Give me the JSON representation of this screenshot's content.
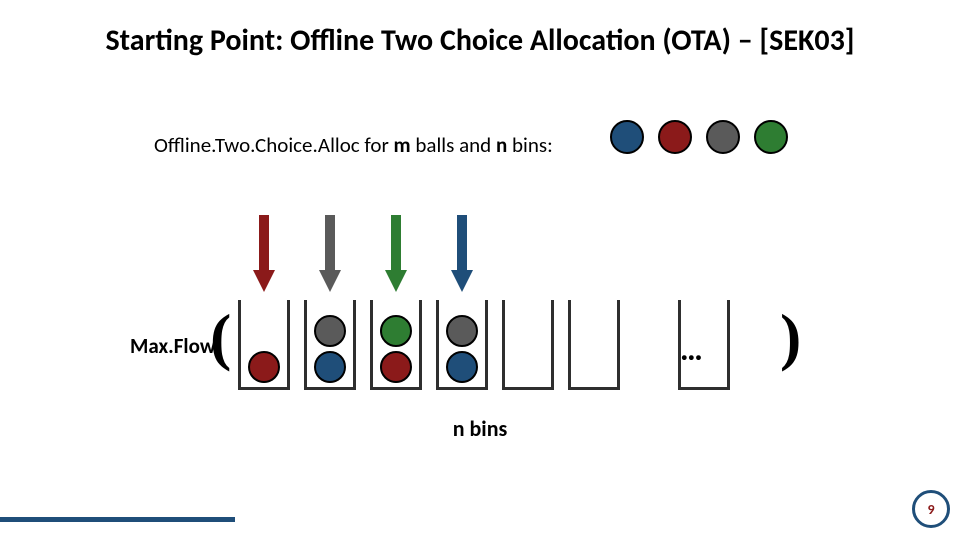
{
  "title": "Starting Point: Offline Two Choice Allocation (OTA) – [SEK03]",
  "subline": {
    "pre": "Offline.Two.Choice.Alloc for ",
    "m": "m",
    "mid": " balls and ",
    "n": "n",
    "post": " bins:"
  },
  "annot_balls": [
    "blue",
    "red",
    "gray",
    "green"
  ],
  "maxflow": "Max.Flow",
  "dots": "…",
  "caption": "n bins",
  "page": "9",
  "arrows": [
    "red",
    "gray",
    "green",
    "blue"
  ],
  "bins": [
    {
      "balls": [
        "red"
      ]
    },
    {
      "balls": [
        "blue",
        "gray"
      ]
    },
    {
      "balls": [
        "red",
        "green"
      ]
    },
    {
      "balls": [
        "blue",
        "gray"
      ]
    },
    {
      "balls": []
    },
    {
      "balls": []
    }
  ],
  "trailing_bins": [
    {
      "balls": []
    }
  ],
  "chart_data": {
    "type": "diagram",
    "title": "Offline Two Choice Allocation (OTA)",
    "balls": [
      "blue",
      "red",
      "gray",
      "green",
      "red",
      "gray",
      "green",
      "blue"
    ],
    "bins_count_shown": 7,
    "bin_contents": [
      [
        "red"
      ],
      [
        "blue",
        "gray"
      ],
      [
        "red",
        "green"
      ],
      [
        "blue",
        "gray"
      ],
      [],
      [],
      []
    ],
    "operation": "Max.Flow"
  }
}
